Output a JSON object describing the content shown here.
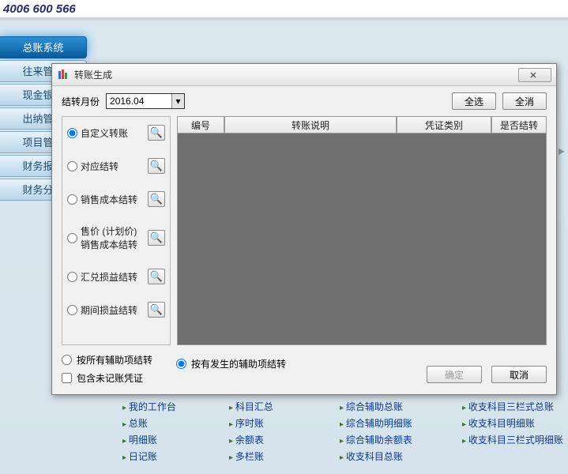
{
  "topbar": {
    "phone": "4006 600 566"
  },
  "sidebar": {
    "items": [
      {
        "label": "总账系统",
        "active": true
      },
      {
        "label": "往来管理"
      },
      {
        "label": "现金银行"
      },
      {
        "label": "出纳管理"
      },
      {
        "label": "项目管理"
      },
      {
        "label": "财务报表"
      },
      {
        "label": "财务分析"
      }
    ]
  },
  "bg_links": {
    "col0": [
      "我的工作台",
      "总账",
      "明细账",
      "日记账"
    ],
    "col1": [
      "科目汇总",
      "序时账",
      "余额表",
      "多栏账"
    ],
    "col2": [
      "综合辅助总账",
      "综合辅助明细账",
      "综合辅助余额表",
      "收支科目总账"
    ],
    "col3": [
      "收支科目三栏式总账",
      "收支科目明细账",
      "收支科目三栏式明细账"
    ]
  },
  "dialog": {
    "title": "转账生成",
    "period_label": "结转月份",
    "period_value": "2016.04",
    "btn_select_all": "全选",
    "btn_select_none": "全消",
    "columns": [
      "编号",
      "转账说明",
      "凭证类别",
      "是否结转"
    ],
    "radios": [
      "自定义转账",
      "对应结转",
      "销售成本结转",
      "售价 (计划价)\n销售成本结转",
      "汇兑损益结转",
      "期间损益结转"
    ],
    "bottom": {
      "radio_all_aux": "按所有辅助项结转",
      "radio_occur_aux": "按有发生的辅助项结转",
      "chk_include_unposted": "包含未记账凭证",
      "btn_ok": "确定",
      "btn_cancel": "取消"
    }
  }
}
